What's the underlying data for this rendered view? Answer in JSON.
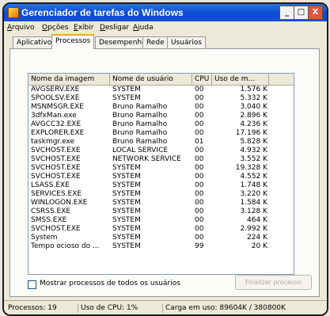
{
  "window": {
    "title": "Gerenciador de tarefas do Windows",
    "minimize": "_",
    "maximize": "□",
    "close": "X"
  },
  "menu": [
    "Arquivo",
    "Opções",
    "Exibir",
    "Desligar",
    "Ajuda"
  ],
  "tabs": [
    "Aplicativos",
    "Processos",
    "Desempenho",
    "Rede",
    "Usuários"
  ],
  "active_tab": "Processos",
  "table": {
    "headers": [
      "Nome da imagem",
      "Nome de usuário",
      "CPU",
      "Uso de m..."
    ],
    "rows": [
      [
        "AVGSERV.EXE",
        "SYSTEM",
        "00",
        "1.576 K"
      ],
      [
        "SPOOLSV.EXE",
        "SYSTEM",
        "00",
        "5.332 K"
      ],
      [
        "MSNMSGR.EXE",
        "Bruno Ramalho",
        "00",
        "3.040 K"
      ],
      [
        "3dfxMan.exe",
        "Bruno Ramalho",
        "00",
        "2.896 K"
      ],
      [
        "AVGCC32.EXE",
        "Bruno Ramalho",
        "00",
        "4.236 K"
      ],
      [
        "EXPLORER.EXE",
        "Bruno Ramalho",
        "00",
        "17.196 K"
      ],
      [
        "taskmgr.exe",
        "Bruno Ramalho",
        "01",
        "5.828 K"
      ],
      [
        "SVCHOST.EXE",
        "LOCAL SERVICE",
        "00",
        "4.932 K"
      ],
      [
        "SVCHOST.EXE",
        "NETWORK SERVICE",
        "00",
        "3.552 K"
      ],
      [
        "SVCHOST.EXE",
        "SYSTEM",
        "00",
        "19.328 K"
      ],
      [
        "SVCHOST.EXE",
        "SYSTEM",
        "00",
        "4.552 K"
      ],
      [
        "LSASS.EXE",
        "SYSTEM",
        "00",
        "1.748 K"
      ],
      [
        "SERVICES.EXE",
        "SYSTEM",
        "00",
        "3.220 K"
      ],
      [
        "WINLOGON.EXE",
        "SYSTEM",
        "00",
        "1.584 K"
      ],
      [
        "CSRSS.EXE",
        "SYSTEM",
        "00",
        "3.128 K"
      ],
      [
        "SMSS.EXE",
        "SYSTEM",
        "00",
        "464 K"
      ],
      [
        "SVCHOST.EXE",
        "SYSTEM",
        "00",
        "2.992 K"
      ],
      [
        "System",
        "SYSTEM",
        "00",
        "224 K"
      ],
      [
        "Tempo ocioso do ...",
        "SYSTEM",
        "99",
        "20 K"
      ]
    ]
  },
  "show_all_label": "Mostrar processos de todos os usuários",
  "end_process_label": "Finalizar processo",
  "status": {
    "processes": "Processos: 19",
    "cpu": "Uso de CPU: 1%",
    "memory": "Carga em uso: 89604K / 380800K"
  }
}
